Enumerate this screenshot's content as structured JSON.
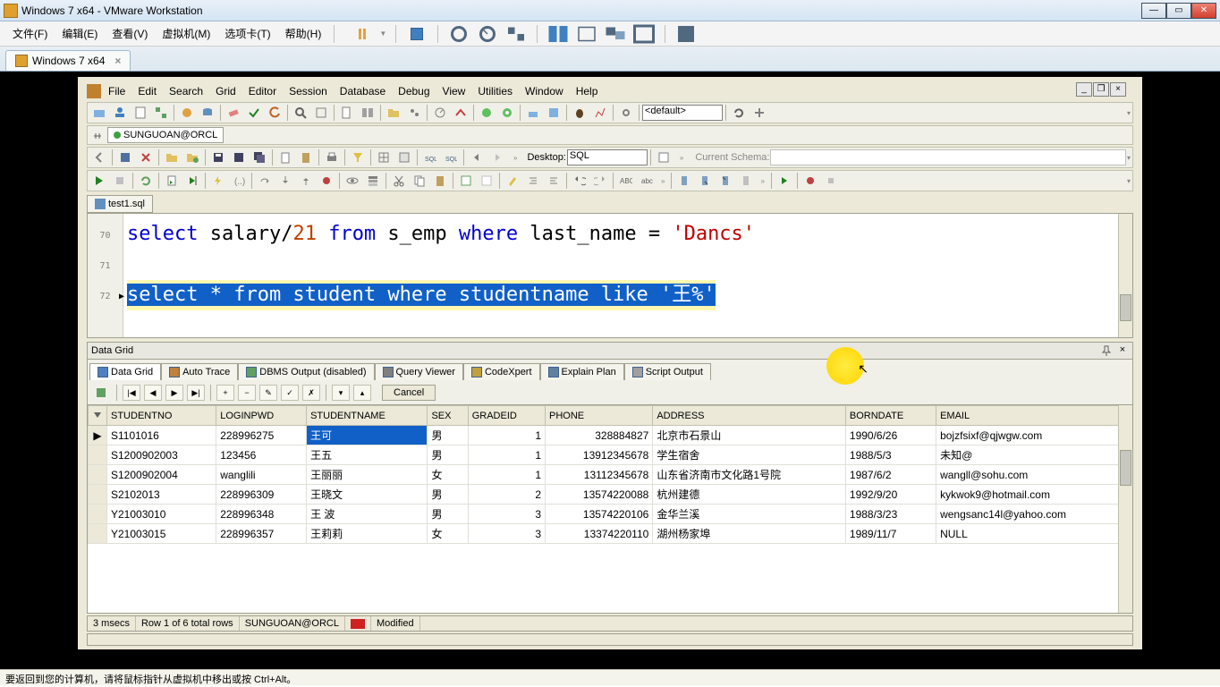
{
  "titlebar": {
    "text": "Windows 7 x64 - VMware Workstation"
  },
  "menubar": [
    "文件(F)",
    "编辑(E)",
    "查看(V)",
    "虚拟机(M)",
    "选项卡(T)",
    "帮助(H)"
  ],
  "tab": {
    "label": "Windows 7 x64"
  },
  "toad": {
    "menu": [
      "File",
      "Edit",
      "Search",
      "Grid",
      "Editor",
      "Session",
      "Database",
      "Debug",
      "View",
      "Utilities",
      "Window",
      "Help"
    ],
    "connection": "SUNGUOAN@ORCL",
    "default_schema": "<default>",
    "desktop_label": "Desktop:",
    "sql_label": "SQL",
    "schema_label": "Current Schema:",
    "sql_tab": "test1.sql",
    "gutter": [
      "70",
      "71",
      "72"
    ],
    "line1_parts": {
      "kw1": "select",
      "t1": " salary/",
      "n1": "21",
      "kw2": " from",
      "t2": " s_emp ",
      "kw3": "where",
      "t3": " last_name = ",
      "s1": "'Dancs'"
    },
    "line3_text": "select * from student where studentname like '王%'",
    "datagrid_title": "Data Grid",
    "result_tabs": [
      "Data Grid",
      "Auto Trace",
      "DBMS Output (disabled)",
      "Query Viewer",
      "CodeXpert",
      "Explain Plan",
      "Script Output"
    ],
    "cancel": "Cancel",
    "columns": [
      "STUDENTNO",
      "LOGINPWD",
      "STUDENTNAME",
      "SEX",
      "GRADEID",
      "PHONE",
      "ADDRESS",
      "BORNDATE",
      "EMAIL"
    ],
    "rows": [
      {
        "marker": "▶",
        "cells": [
          "S1101016",
          "228996275",
          "王可",
          "男",
          "1",
          "328884827",
          "北京市石景山",
          "1990/6/26",
          "bojzfsixf@qjwgw.com"
        ]
      },
      {
        "marker": "",
        "cells": [
          "S1200902003",
          "123456",
          "王五",
          "男",
          "1",
          "13912345678",
          "学生宿舍",
          "1988/5/3",
          "未知@"
        ]
      },
      {
        "marker": "",
        "cells": [
          "S1200902004",
          "wanglili",
          "王丽丽",
          "女",
          "1",
          "13112345678",
          "山东省济南市文化路1号院",
          "1987/6/2",
          "wangll@sohu.com"
        ]
      },
      {
        "marker": "",
        "cells": [
          "S2102013",
          "228996309",
          "王晓文",
          "男",
          "2",
          "13574220088",
          "杭州建德",
          "1992/9/20",
          "kykwok9@hotmail.com"
        ]
      },
      {
        "marker": "",
        "cells": [
          "Y21003010",
          "228996348",
          "王 波",
          "男",
          "3",
          "13574220106",
          "金华兰溪",
          "1988/3/23",
          "wengsanc14l@yahoo.com"
        ]
      },
      {
        "marker": "",
        "cells": [
          "Y21003015",
          "228996357",
          "王莉莉",
          "女",
          "3",
          "13374220110",
          "湖州杨家埠",
          "1989/11/7",
          "NULL"
        ]
      }
    ],
    "status": {
      "time": "3 msecs",
      "rows": "Row 1 of 6 total rows",
      "conn": "SUNGUOAN@ORCL",
      "modified": "Modified"
    }
  },
  "hint": "要返回到您的计算机，请将鼠标指针从虚拟机中移出或按 Ctrl+Alt。"
}
